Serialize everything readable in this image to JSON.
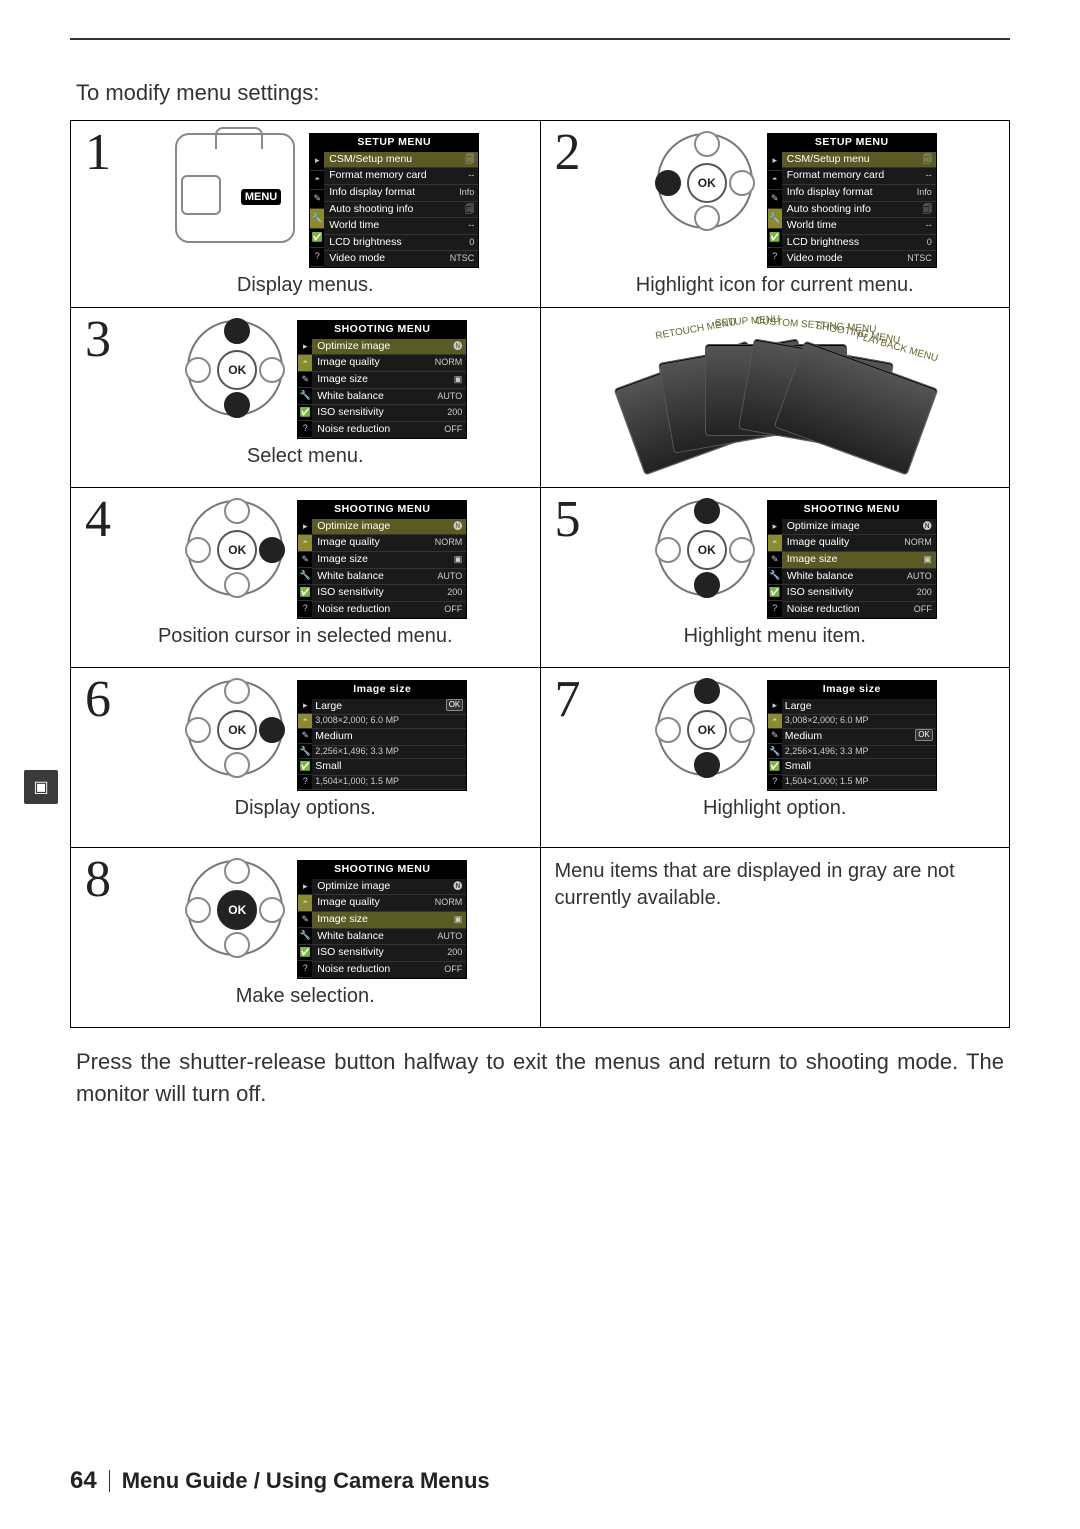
{
  "intro": "To modify menu settings:",
  "outro": "Press the shutter-release button halfway to exit the menus and return to shooting mode. The monitor will turn off.",
  "footer": {
    "page": "64",
    "title": "Menu Guide / Using Camera Menus"
  },
  "side_tab_icon": "▣",
  "ok_label": "OK",
  "menu_btn_label": "MENU",
  "steps": [
    {
      "num": "1",
      "caption": "Display menus."
    },
    {
      "num": "2",
      "caption": "Highlight icon for current menu."
    },
    {
      "num": "3",
      "caption": "Select menu."
    },
    {
      "num": "4",
      "caption": "Position cursor in selected menu."
    },
    {
      "num": "5",
      "caption": "Highlight menu item."
    },
    {
      "num": "6",
      "caption": "Display options."
    },
    {
      "num": "7",
      "caption": "Highlight option."
    },
    {
      "num": "8",
      "caption": "Make selection."
    }
  ],
  "note": "Menu items that are displayed in gray are not currently available.",
  "lcd": {
    "setup": {
      "title": "SETUP MENU",
      "items": [
        {
          "l": "CSM/Setup menu",
          "r": "🗐"
        },
        {
          "l": "Format memory card",
          "r": "--"
        },
        {
          "l": "Info display format",
          "r": "Info"
        },
        {
          "l": "Auto shooting info",
          "r": "🗐"
        },
        {
          "l": "World time",
          "r": "--"
        },
        {
          "l": "LCD brightness",
          "r": "0"
        },
        {
          "l": "Video mode",
          "r": "NTSC"
        }
      ]
    },
    "shooting": {
      "title": "SHOOTING MENU",
      "items": [
        {
          "l": "Optimize image",
          "r": "🅝"
        },
        {
          "l": "Image quality",
          "r": "NORM"
        },
        {
          "l": "Image size",
          "r": "▣"
        },
        {
          "l": "White balance",
          "r": "AUTO"
        },
        {
          "l": "ISO sensitivity",
          "r": "200"
        },
        {
          "l": "Noise reduction",
          "r": "OFF"
        }
      ]
    },
    "image_size": {
      "title": "Image size",
      "options": [
        {
          "name": "Large",
          "detail": "3,008×2,000; 6.0 MP"
        },
        {
          "name": "Medium",
          "detail": "2,256×1,496; 3.3 MP"
        },
        {
          "name": "Small",
          "detail": "1,504×1,000; 1.5 MP"
        }
      ],
      "ok_badge": "OK"
    }
  },
  "fan_labels": [
    "RETOUCH MENU",
    "SETUP MENU",
    "CUSTOM SETTING MENU",
    "SHOOTING MENU",
    "PLAYBACK MENU"
  ]
}
